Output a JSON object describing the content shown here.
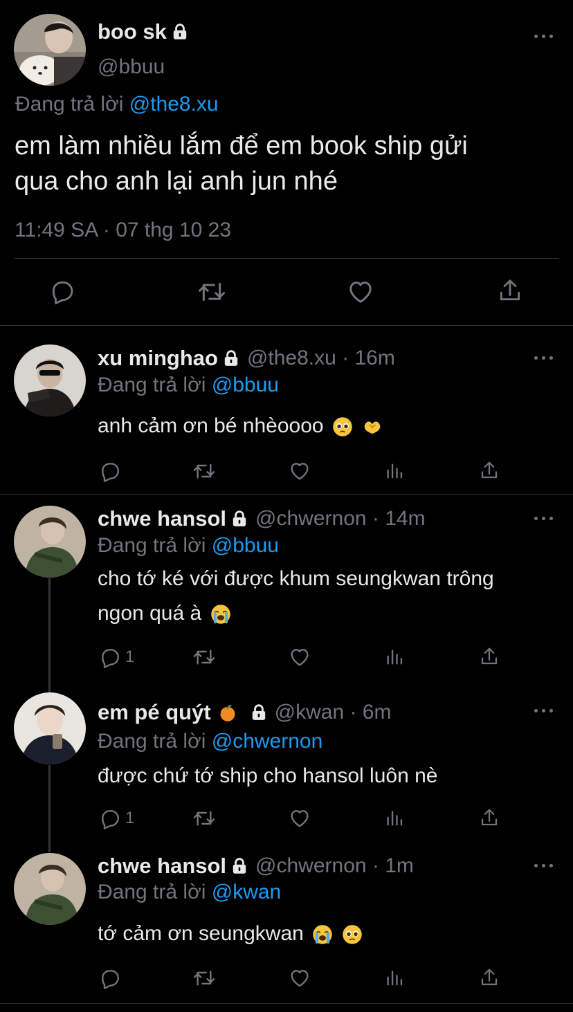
{
  "main_tweet": {
    "display_name": "boo sk",
    "handle": "@bbuu",
    "replying_prefix": "Đang trả lời",
    "replying_to": "@the8.xu",
    "text_line1": "em làm nhiều lắm để em book ship gửi",
    "text_line2": "qua cho anh lại anh jun nhé",
    "timestamp": "11:49 SA · 07 thg 10 23"
  },
  "replies": [
    {
      "display_name": "xu minghao",
      "handle_meta": "@the8.xu · 16m",
      "replying_prefix": "Đang trả lời",
      "replying_to": "@bbuu",
      "text": "anh cảm ơn bé nhèoooo",
      "reply_count": ""
    },
    {
      "display_name": "chwe hansol",
      "handle_meta": "@chwernon · 14m",
      "replying_prefix": "Đang trả lời",
      "replying_to": "@bbuu",
      "text_line1": "cho tớ ké với được khum seungkwan trông",
      "text_line2": "ngon quá à",
      "reply_count": "1"
    },
    {
      "display_name": "em pé quýt",
      "handle_meta": "@kwan · 6m",
      "replying_prefix": "Đang trả lời",
      "replying_to": "@chwernon",
      "text": "được chứ tớ ship cho hansol luôn nè",
      "reply_count": "1"
    },
    {
      "display_name": "chwe hansol",
      "handle_meta": "@chwernon · 1m",
      "replying_prefix": "Đang trả lời",
      "replying_to": "@kwan",
      "text": "tớ cảm ơn seungkwan",
      "reply_count": ""
    }
  ],
  "colors": {
    "background": "#000000",
    "primary_text": "#e7e9ea",
    "secondary_text": "#71767b",
    "accent": "#1d9bf0",
    "divider": "#2f3336"
  },
  "icons": {
    "reply": "reply-icon",
    "retweet": "retweet-icon",
    "like": "heart-icon",
    "views": "views-icon",
    "share": "share-icon",
    "lock": "lock-icon",
    "more": "more-icon"
  }
}
